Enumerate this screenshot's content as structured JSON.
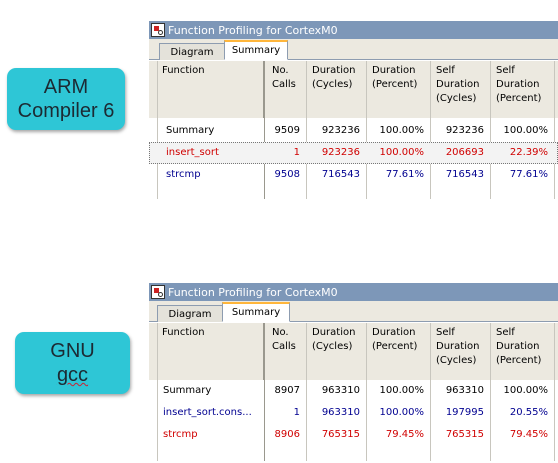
{
  "badges": {
    "arm": {
      "line1": "ARM",
      "line2": "Compiler 6"
    },
    "gnu": {
      "line1": "GNU",
      "line2": "gcc"
    }
  },
  "window_title": "Function Profiling for CortexM0",
  "tabs": [
    "Diagram",
    "Summary"
  ],
  "active_tab": "Summary",
  "columns": {
    "function": "Function",
    "calls_1": "No.",
    "calls_2": "Calls",
    "dur_cycles_1": "Duration",
    "dur_cycles_2": "(Cycles)",
    "dur_pct_1": "Duration",
    "dur_pct_2": "(Percent)",
    "self_cycles_1": "Self",
    "self_cycles_2": "Duration",
    "self_cycles_3": "(Cycles)",
    "self_pct_1": "Self",
    "self_pct_2": "Duration",
    "self_pct_3": "(Percent)"
  },
  "colors": {
    "summary": "#000000",
    "insert_sort_arm": "#d00000",
    "strcmp_arm": "#000090",
    "insert_sort_gnu": "#000090",
    "strcmp_gnu": "#d00000"
  },
  "arm_rows": [
    {
      "function": "Summary",
      "calls": "9509",
      "dur_cycles": "923236",
      "dur_pct": "100.00%",
      "self_cycles": "923236",
      "self_pct": "100.00%"
    },
    {
      "function": "insert_sort",
      "calls": "1",
      "dur_cycles": "923236",
      "dur_pct": "100.00%",
      "self_cycles": "206693",
      "self_pct": "22.39%"
    },
    {
      "function": "strcmp",
      "calls": "9508",
      "dur_cycles": "716543",
      "dur_pct": "77.61%",
      "self_cycles": "716543",
      "self_pct": "77.61%"
    }
  ],
  "gnu_rows": [
    {
      "function": "Summary",
      "calls": "8907",
      "dur_cycles": "963310",
      "dur_pct": "100.00%",
      "self_cycles": "963310",
      "self_pct": "100.00%"
    },
    {
      "function": "insert_sort.cons...",
      "calls": "1",
      "dur_cycles": "963310",
      "dur_pct": "100.00%",
      "self_cycles": "197995",
      "self_pct": "20.55%"
    },
    {
      "function": "strcmp",
      "calls": "8906",
      "dur_cycles": "765315",
      "dur_pct": "79.45%",
      "self_cycles": "765315",
      "self_pct": "79.45%"
    }
  ]
}
